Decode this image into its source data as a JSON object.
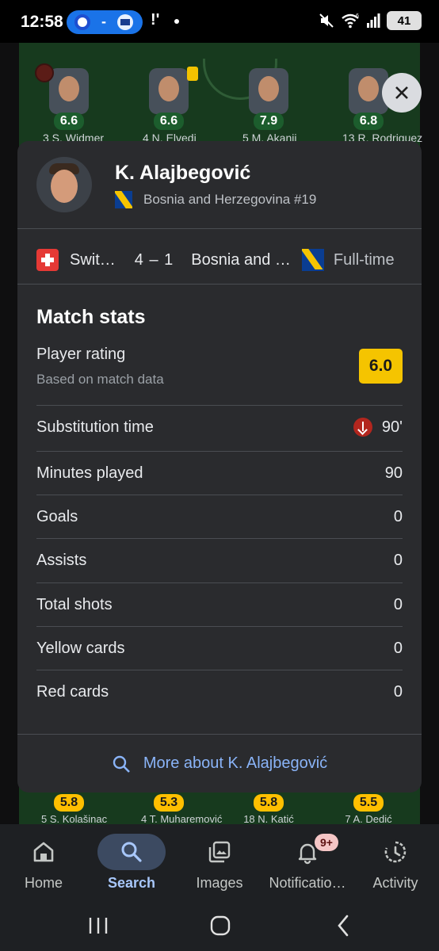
{
  "status_bar": {
    "time": "12:58",
    "pill_separator": "-",
    "misc": "!'",
    "wifi_label": "6",
    "battery": "41"
  },
  "lineup_top": [
    {
      "rating": "6.6",
      "name": "3 S. Widmer"
    },
    {
      "rating": "6.6",
      "name": "4 N. Elvedi"
    },
    {
      "rating": "7.9",
      "name": "5 M. Akanji"
    },
    {
      "rating": "6.8",
      "name": "13 R. Rodriguez"
    }
  ],
  "lineup_bottom": [
    {
      "rating": "5.8",
      "name": "5 S. Kolašinac"
    },
    {
      "rating": "5.3",
      "name": "4 T. Muharemović"
    },
    {
      "rating": "5.8",
      "name": "18 N. Katić"
    },
    {
      "rating": "5.5",
      "name": "7 A. Dedić"
    }
  ],
  "player": {
    "name": "K. Alajbegović",
    "team_number": "Bosnia and Herzegovina #19"
  },
  "match": {
    "home_team": "Swit…",
    "score": "4 – 1",
    "away_team": "Bosnia and …",
    "status": "Full-time"
  },
  "stats": {
    "title": "Match stats",
    "rating_label": "Player rating",
    "rating_note": "Based on match data",
    "rating_value": "6.0",
    "rows": [
      {
        "label": "Substitution time",
        "value": "90'"
      },
      {
        "label": "Minutes played",
        "value": "90"
      },
      {
        "label": "Goals",
        "value": "0"
      },
      {
        "label": "Assists",
        "value": "0"
      },
      {
        "label": "Total shots",
        "value": "0"
      },
      {
        "label": "Yellow cards",
        "value": "0"
      },
      {
        "label": "Red cards",
        "value": "0"
      }
    ],
    "more_link": "More about K. Alajbegović"
  },
  "nav": {
    "items": [
      {
        "label": "Home",
        "icon": "home-icon"
      },
      {
        "label": "Search",
        "icon": "search-icon"
      },
      {
        "label": "Images",
        "icon": "images-icon"
      },
      {
        "label": "Notificatio…",
        "icon": "bell-icon",
        "badge": "9+"
      },
      {
        "label": "Activity",
        "icon": "activity-icon"
      }
    ],
    "active": "Search"
  },
  "colors": {
    "accent": "#8ab4f8",
    "rating_yellow": "#f5c400",
    "card_bg": "#2a2b2e"
  }
}
